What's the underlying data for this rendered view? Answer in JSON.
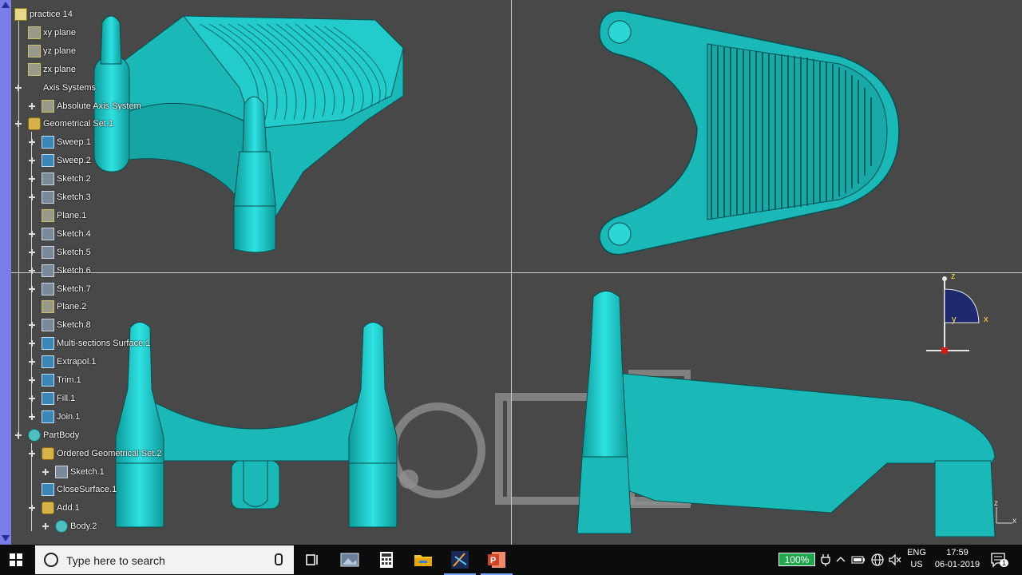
{
  "tree": {
    "items": [
      {
        "label": "practice 14",
        "icon": "root"
      },
      {
        "label": "xy plane",
        "icon": "plane"
      },
      {
        "label": "yz plane",
        "icon": "plane"
      },
      {
        "label": "zx plane",
        "icon": "plane"
      },
      {
        "label": "Axis Systems",
        "icon": "axis"
      },
      {
        "label": "Absolute Axis System",
        "icon": "plane"
      },
      {
        "label": "Geometrical Set.1",
        "icon": "geoset"
      },
      {
        "label": "Sweep.1",
        "icon": "surface"
      },
      {
        "label": "Sweep.2",
        "icon": "surface"
      },
      {
        "label": "Sketch.2",
        "icon": "sketch"
      },
      {
        "label": "Sketch.3",
        "icon": "sketch"
      },
      {
        "label": "Plane.1",
        "icon": "plane"
      },
      {
        "label": "Sketch.4",
        "icon": "sketch"
      },
      {
        "label": "Sketch.5",
        "icon": "sketch"
      },
      {
        "label": "Sketch.6",
        "icon": "sketch"
      },
      {
        "label": "Sketch.7",
        "icon": "sketch"
      },
      {
        "label": "Plane.2",
        "icon": "plane"
      },
      {
        "label": "Sketch.8",
        "icon": "sketch"
      },
      {
        "label": "Multi-sections Surface.1",
        "icon": "surface"
      },
      {
        "label": "Extrapol.1",
        "icon": "surface"
      },
      {
        "label": "Trim.1",
        "icon": "surface"
      },
      {
        "label": "Fill.1",
        "icon": "surface"
      },
      {
        "label": "Join.1",
        "icon": "surface"
      },
      {
        "label": "PartBody",
        "icon": "body"
      },
      {
        "label": "Ordered Geometrical Set.2",
        "icon": "geoset"
      },
      {
        "label": "Sketch.1",
        "icon": "sketch"
      },
      {
        "label": "CloseSurface.1",
        "icon": "surface"
      },
      {
        "label": "Add.1",
        "icon": "geoset"
      },
      {
        "label": "Body.2",
        "icon": "body"
      }
    ]
  },
  "compass": {
    "z_label": "z",
    "x_label": "x",
    "y_label": "y"
  },
  "corner_axis": {
    "z_label": "z",
    "x_label": "x"
  },
  "taskbar": {
    "search_placeholder": "Type here to search",
    "battery_percent": "100%",
    "language": "ENG",
    "region": "US",
    "time": "17:59",
    "date": "06-01-2019",
    "notification_count": "1",
    "apps": [
      "task-view",
      "photos",
      "calculator",
      "file-explorer",
      "catia",
      "powerpoint"
    ]
  },
  "colors": {
    "model_fill": "#1fbfbf",
    "model_shade": "#0f8f8f",
    "viewport_bg": "#484848",
    "taskbar_bg": "#0c0c0c"
  }
}
